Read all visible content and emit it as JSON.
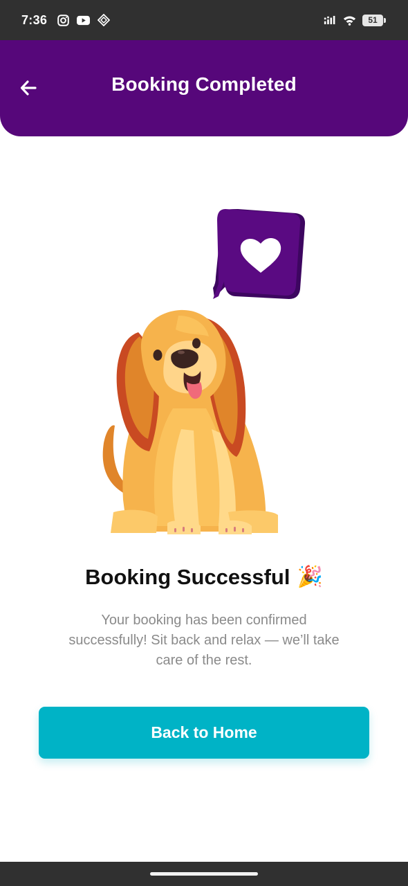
{
  "status_bar": {
    "time": "7:36",
    "left_icons": [
      "instagram-icon",
      "youtube-icon",
      "app-diamond-icon"
    ],
    "right_icons": [
      "signal-icon",
      "wifi-icon",
      "battery-icon"
    ],
    "battery_level": "51"
  },
  "header": {
    "title": "Booking Completed",
    "back_icon": "arrow-left-icon",
    "background": "#56077a"
  },
  "illustration": {
    "subject": "dog-with-heart-speech-bubble",
    "bubble_color": "#5a0a82"
  },
  "content": {
    "title": "Booking Successful",
    "title_emoji": "🎉",
    "message": "Your booking has been confirmed successfully! Sit back and relax — we’ll take care of the rest."
  },
  "actions": {
    "home_button_label": "Back to Home",
    "accent": "#00b3c6"
  }
}
